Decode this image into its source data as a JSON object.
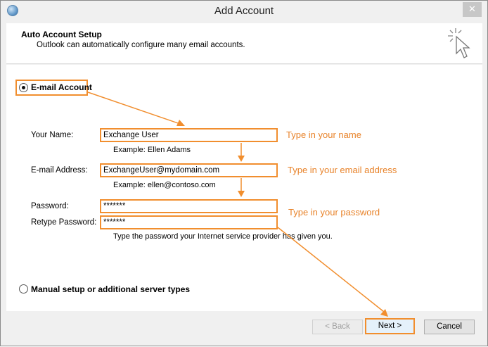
{
  "window": {
    "title": "Add Account",
    "close_glyph": "✕"
  },
  "header": {
    "title": "Auto Account Setup",
    "subtitle": "Outlook can automatically configure many email accounts."
  },
  "email_account": {
    "option_label": "E-mail Account",
    "selected": true,
    "name": {
      "label": "Your Name:",
      "value": "Exchange User",
      "example": "Example: Ellen Adams",
      "annotation": "Type in your name"
    },
    "email": {
      "label": "E-mail Address:",
      "value": "ExchangeUser@mydomain.com",
      "example": "Example: ellen@contoso.com",
      "annotation": "Type in your email address"
    },
    "password": {
      "label": "Password:",
      "value": "*******",
      "annotation": "Type in your password"
    },
    "retype_password": {
      "label": "Retype Password:",
      "value": "*******"
    },
    "password_hint": "Type the password your Internet service provider has given you."
  },
  "manual_setup": {
    "option_label": "Manual setup or additional server types",
    "selected": false
  },
  "footer": {
    "back_label": "< Back",
    "next_label": "Next >",
    "cancel_label": "Cancel"
  },
  "colors": {
    "annotation_accent": "#f18e2e"
  },
  "icons": {
    "app": "outlook-globe-icon",
    "setup": "cursor-sparkle-icon"
  }
}
